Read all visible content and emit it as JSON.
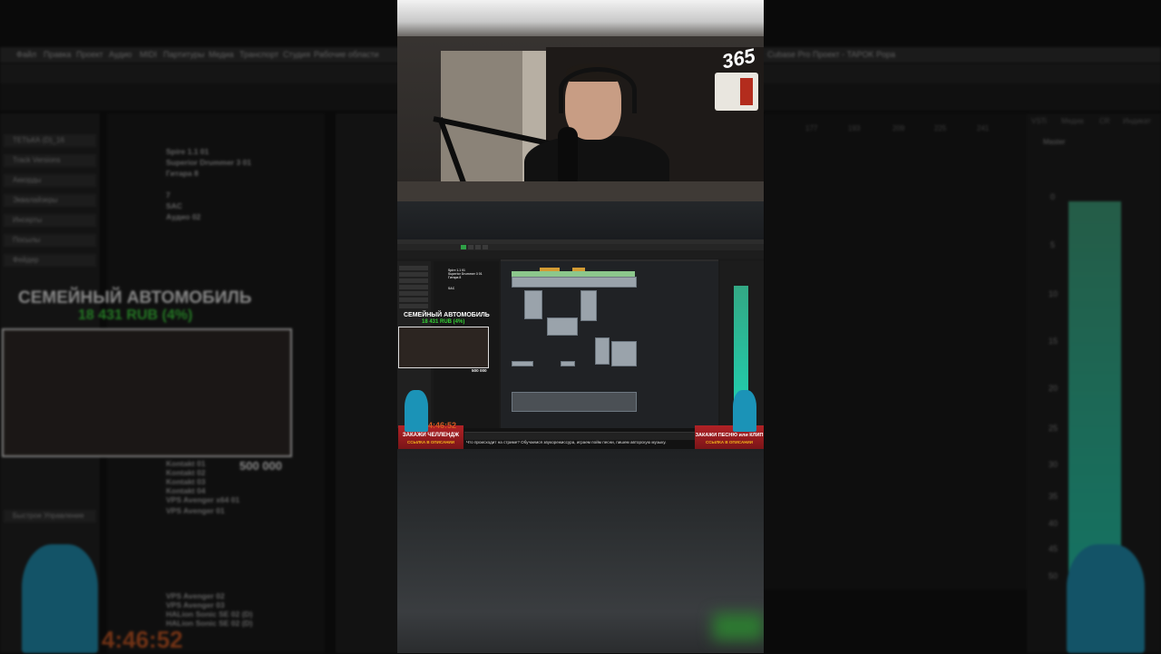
{
  "background": {
    "menu": [
      "Файл",
      "Правка",
      "Проект",
      "Аудио",
      "MIDI",
      "Партитуры",
      "Медиа",
      "Транспорт",
      "Студия",
      "Рабочие области",
      "Окна"
    ],
    "window_title": "Cubase Pro Проект - TAPOK Popa",
    "inspector": [
      "ТЕТЬКА (D)_16",
      "Track Versions",
      "Аккорды",
      "Эквалайзеры",
      "Инсерты",
      "Посылы",
      "Фейдер"
    ],
    "tracks": [
      "Spire 1.1 01",
      "Superior Drummer 3 01",
      "Гитара 8",
      "7",
      "SAC",
      "Аудио 02",
      "Kontakt 01",
      "Kontakt 02",
      "Kontakt 03",
      "Kontakt 04",
      "VPS Avenger x64 01",
      "VPS Avenger 01",
      "VPS Avenger 02",
      "VPS Avenger 03",
      "HALion Sonic SE 02 (D)",
      "HALion Sonic SE 02 (D)"
    ],
    "ruler_marks": [
      "177",
      "193",
      "209",
      "225",
      "241"
    ],
    "mixer_tabs": [
      "VSTi",
      "Медиа",
      "CR",
      "Индикат"
    ],
    "mixer_channel": "Master",
    "meter_scale": [
      "0",
      "5",
      "10",
      "15",
      "20",
      "25",
      "30",
      "35",
      "40",
      "45",
      "50"
    ],
    "overlay": {
      "title": "СЕМЕЙНЫЙ АВТОМОБИЛЬ",
      "prize": "18 431 RUB (4%)",
      "goal": "500 000",
      "timer": "4:46:52"
    },
    "quick_controls": "Быстрое Управление"
  },
  "video": {
    "logo": "365"
  },
  "screen": {
    "overlay": {
      "title": "СЕМЕЙНЫЙ АВТОМОБИЛЬ",
      "prize": "18 431 RUB (4%)",
      "goal": "500 000",
      "timer": "4:46:52",
      "left_banner": "ЗАКАЖИ ЧЕЛЛЕНДЖ",
      "left_banner_sub": "ССЫЛКА В ОПИСАНИИ",
      "right_banner": "ЗАКАЖИ ПЕСНЮ или КЛИП",
      "right_banner_sub": "ССЫЛКА В ОПИСАНИИ"
    },
    "ticker": "Что происходит на стриме? Обучаемся звукорежиссура, играем пойм песни, пишем авторскую музыку."
  },
  "colors": {
    "meter": "#1fd2b3",
    "prize": "#36d236",
    "timer": "#d45a22",
    "hud": "#b02226"
  }
}
